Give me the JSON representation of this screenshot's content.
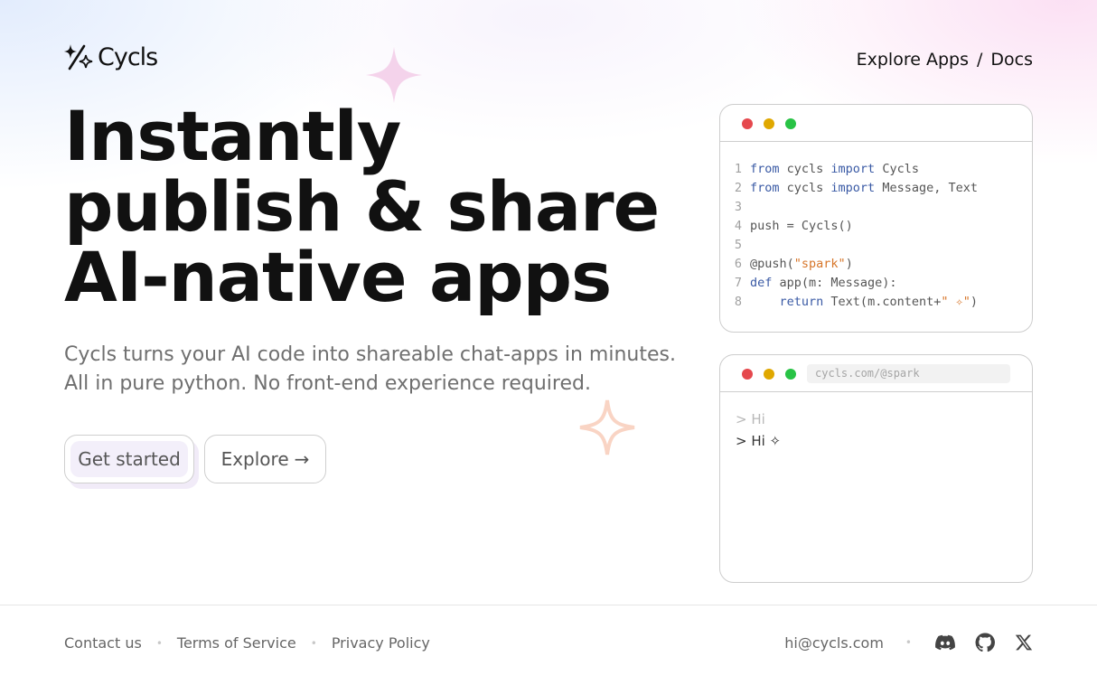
{
  "brand": {
    "name": "Cycls"
  },
  "nav": {
    "explore_apps": "Explore Apps",
    "separator": "/",
    "docs": "Docs"
  },
  "hero": {
    "line1": "Instantly",
    "line2": "publish & share",
    "line3": "AI-native apps",
    "sub_line1": "Cycls turns your AI code into shareable chat-apps in minutes.",
    "sub_line2": "All in pure python. No front-end experience required."
  },
  "buttons": {
    "get_started": "Get started",
    "explore": "Explore",
    "explore_arrow": "→"
  },
  "code_window": {
    "lines": [
      {
        "n": "1",
        "parts": [
          [
            "kw",
            "from"
          ],
          [
            "t",
            " cycls "
          ],
          [
            "kw",
            "import"
          ],
          [
            "t",
            " Cycls"
          ]
        ]
      },
      {
        "n": "2",
        "parts": [
          [
            "kw",
            "from"
          ],
          [
            "t",
            " cycls "
          ],
          [
            "kw",
            "import"
          ],
          [
            "t",
            " Message, Text"
          ]
        ]
      },
      {
        "n": "3",
        "parts": []
      },
      {
        "n": "4",
        "parts": [
          [
            "t",
            "push = Cycls()"
          ]
        ]
      },
      {
        "n": "5",
        "parts": []
      },
      {
        "n": "6",
        "parts": [
          [
            "t",
            "@push("
          ],
          [
            "str",
            "\"spark\""
          ],
          [
            "t",
            ")"
          ]
        ]
      },
      {
        "n": "7",
        "parts": [
          [
            "kw",
            "def"
          ],
          [
            "t",
            " app(m: Message):"
          ]
        ]
      },
      {
        "n": "8",
        "parts": [
          [
            "t",
            "    "
          ],
          [
            "kw",
            "return"
          ],
          [
            "t",
            " Text(m.content+"
          ],
          [
            "str",
            "\" ✧\""
          ],
          [
            "t",
            ")"
          ]
        ]
      }
    ]
  },
  "chat_window": {
    "url": "cycls.com/@spark",
    "messages": [
      "> Hi",
      "> Hi ✧"
    ]
  },
  "footer": {
    "contact": "Contact us",
    "terms": "Terms of Service",
    "privacy": "Privacy Policy",
    "bullet": "•",
    "email": "hi@cycls.com"
  },
  "icons": {
    "logo": "sparkle-slash-logo-icon",
    "discord": "discord-icon",
    "github": "github-icon",
    "x": "x-icon"
  },
  "colors": {
    "accent_pink": "#f1c6e4",
    "accent_orange": "#f7c9b5",
    "dot_red": "#e5484d",
    "dot_yellow": "#e0a800",
    "dot_green": "#28c345",
    "keyword": "#3a5aa5",
    "string": "#d7762a"
  }
}
